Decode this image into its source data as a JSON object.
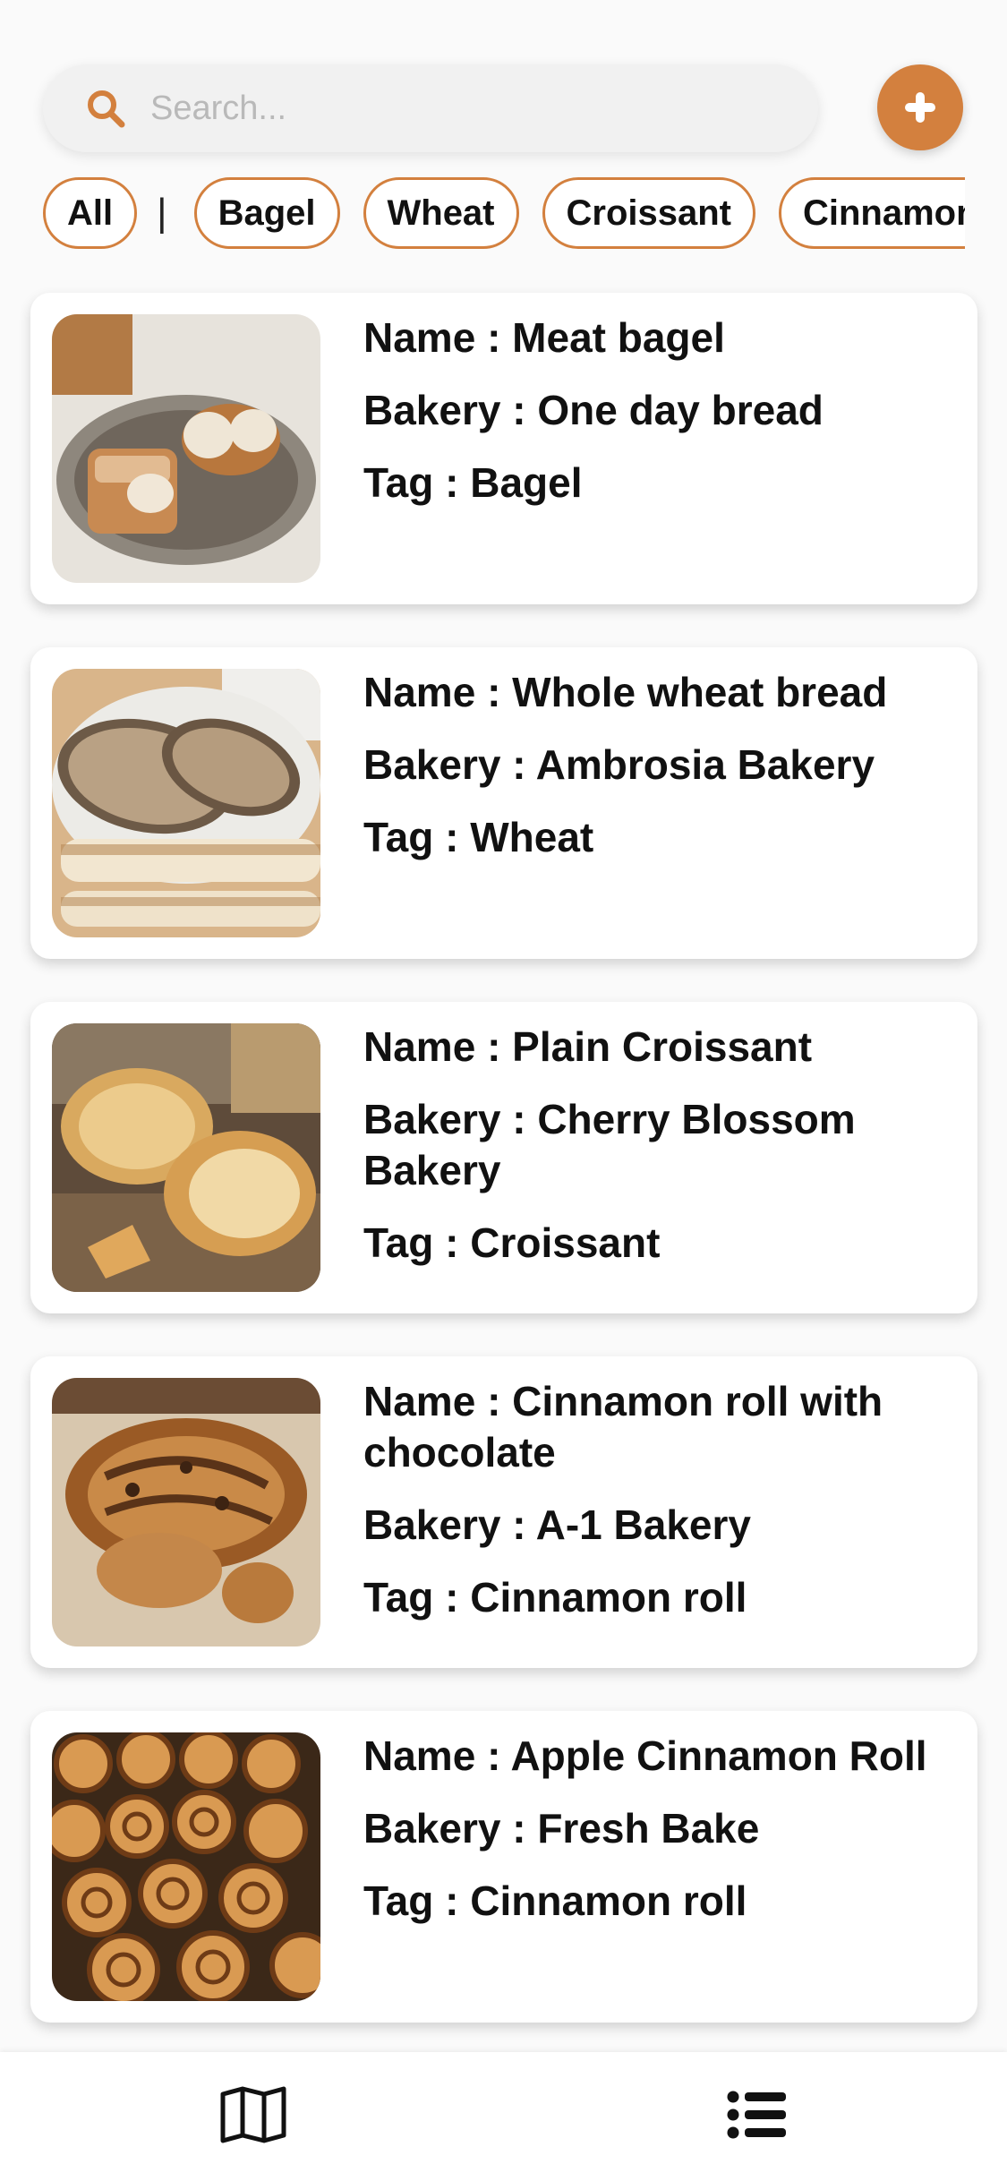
{
  "search": {
    "placeholder": "Search...",
    "value": ""
  },
  "add_button": {
    "icon": "plus-icon"
  },
  "filters": {
    "all_label": "All",
    "chips": [
      "Bagel",
      "Wheat",
      "Croissant",
      "Cinnamon"
    ]
  },
  "breads": [
    {
      "name": "Name : Meat bagel",
      "bakery": "Bakery : One day bread",
      "tag": "Tag : Bagel"
    },
    {
      "name": "Name : Whole wheat bread",
      "bakery": "Bakery : Ambrosia Bakery",
      "tag": "Tag : Wheat"
    },
    {
      "name": "Name : Plain Croissant",
      "bakery": "Bakery : Cherry Blossom Bakery",
      "tag": "Tag : Croissant"
    },
    {
      "name": "Name : Cinnamon roll with chocolate",
      "bakery": "Bakery : A-1 Bakery",
      "tag": "Tag : Cinnamon roll"
    },
    {
      "name": "Name : Apple Cinnamon Roll",
      "bakery": "Bakery : Fresh Bake",
      "tag": "Tag : Cinnamon roll"
    }
  ],
  "bottom_nav": {
    "items": [
      "map-icon",
      "list-icon"
    ]
  },
  "colors": {
    "accent": "#d3803e",
    "text": "#111111",
    "background": "#fafafa"
  }
}
